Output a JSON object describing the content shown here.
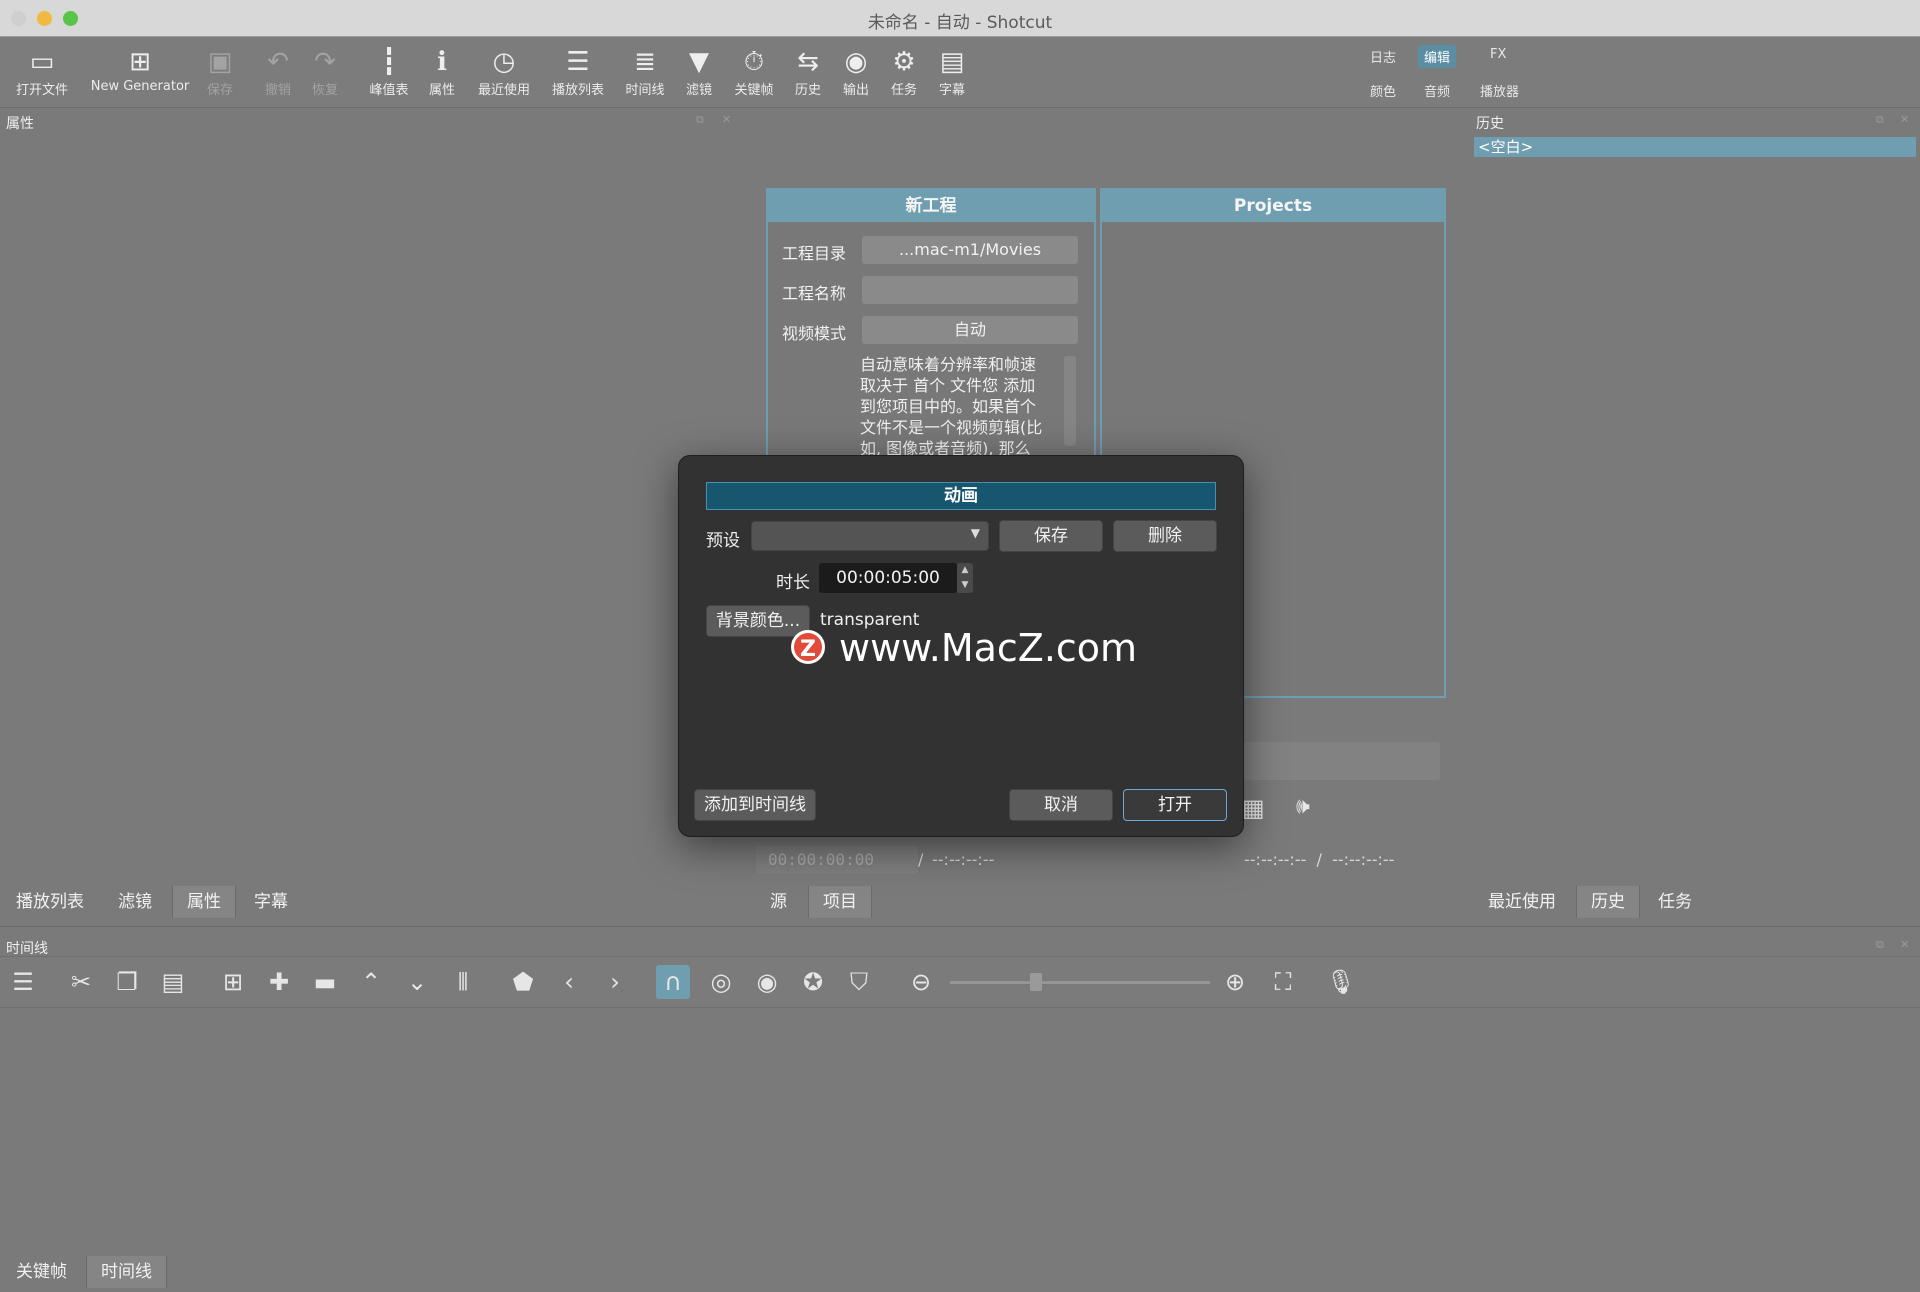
{
  "window": {
    "title": "未命名 - 自动 - Shotcut"
  },
  "toolbar": {
    "items": [
      "打开文件",
      "New Generator",
      "保存",
      "撤销",
      "恢复",
      "峰值表",
      "属性",
      "最近使用",
      "播放列表",
      "时间线",
      "滤镜",
      "关键帧",
      "历史",
      "输出",
      "任务",
      "字幕"
    ],
    "layouts": {
      "log": "日志",
      "edit": "编辑",
      "fx": "FX",
      "color": "颜色",
      "audio": "音频",
      "player": "播放器"
    }
  },
  "left_panel": {
    "title": "属性",
    "tabs": [
      "播放列表",
      "滤镜",
      "属性",
      "字幕"
    ]
  },
  "right_panel": {
    "title": "历史",
    "item": "<空白>",
    "tabs": [
      "最近使用",
      "历史",
      "任务"
    ]
  },
  "center": {
    "new_project": {
      "header": "新工程",
      "dir_label": "工程目录",
      "dir_value": "...mac-m1/Movies",
      "name_label": "工程名称",
      "mode_label": "视频模式",
      "mode_value": "自动",
      "desc": [
        "自动意味着分辨率和帧速",
        "取决于 首个 文件您 添加",
        "到您项目中的。如果首个",
        "文件不是一个视频剪辑(比",
        "如, 图像或者音频), 那么"
      ]
    },
    "projects_header": "Projects",
    "timecode": "00:00:00:00",
    "timecode_sep": "/",
    "timecode_total": "--:--:--:--",
    "right_timecode": "--:--:--:--  /  --:--:--:--",
    "tabs": [
      "源",
      "项目"
    ]
  },
  "dialog": {
    "title": "动画",
    "preset_label": "预设",
    "save": "保存",
    "delete": "删除",
    "duration_label": "时长",
    "duration": "00:00:05:00",
    "bg_button": "背景颜色...",
    "bg_value": "transparent",
    "watermark": "www.MacZ.com",
    "add_timeline": "添加到时间线",
    "cancel": "取消",
    "open": "打开"
  },
  "timeline": {
    "title": "时间线",
    "tabs": [
      "关键帧",
      "时间线"
    ]
  },
  "colors": {
    "accent": "#6f9eb1",
    "dialog_title": "#17566f",
    "traffic": [
      "#d0d0d0",
      "#f0b93f",
      "#59c446"
    ]
  }
}
